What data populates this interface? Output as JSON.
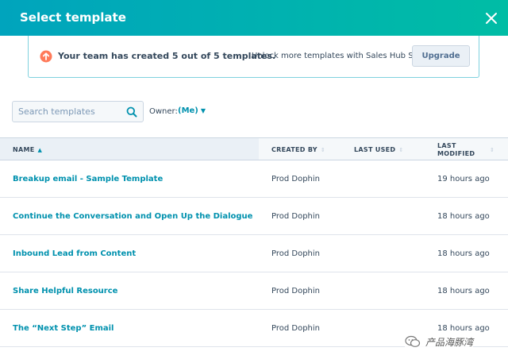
{
  "header": {
    "title": "Select template",
    "close_icon": "close-icon"
  },
  "banner": {
    "icon": "arrow-up-circle-icon",
    "title": "Your team has created 5 out of 5 templates.",
    "text": "Unlock more templates with Sales Hub Starter.",
    "button_label": "Upgrade"
  },
  "search": {
    "placeholder": "Search templates",
    "value": "",
    "icon": "search-icon"
  },
  "owner": {
    "label": "Owner:",
    "value": "(Me)"
  },
  "table": {
    "columns": {
      "name": "NAME",
      "created_by": "CREATED BY",
      "last_used": "LAST USED",
      "last_modified_line1": "LAST",
      "last_modified_line2": "MODIFIED"
    },
    "rows": [
      {
        "name": "Breakup email - Sample Template",
        "created_by": "Prod Dophin",
        "last_used": "",
        "last_modified": "19 hours ago"
      },
      {
        "name": "Continue the Conversation and Open Up the Dialogue",
        "created_by": "Prod Dophin",
        "last_used": "",
        "last_modified": "18 hours ago"
      },
      {
        "name": "Inbound Lead from Content",
        "created_by": "Prod Dophin",
        "last_used": "",
        "last_modified": "18 hours ago"
      },
      {
        "name": "Share Helpful Resource",
        "created_by": "Prod Dophin",
        "last_used": "",
        "last_modified": "18 hours ago"
      },
      {
        "name": "The “Next Step” Email",
        "created_by": "Prod Dophin",
        "last_used": "",
        "last_modified": "18 hours ago"
      }
    ]
  },
  "watermark": {
    "text": "产品海豚湾"
  },
  "colors": {
    "header_gradient_start": "#00a4bd",
    "header_gradient_end": "#00bda5",
    "link": "#0091ae",
    "banner_icon": "#ff7a59",
    "text": "#33475b"
  }
}
